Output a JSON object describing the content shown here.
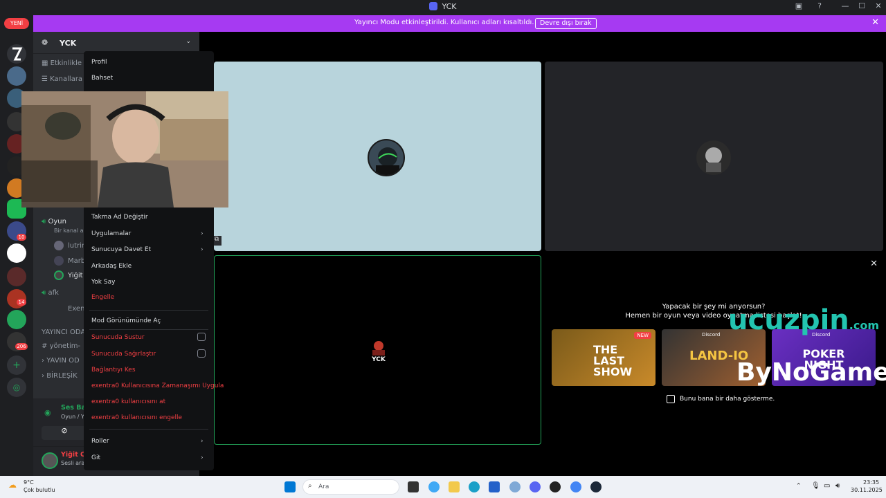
{
  "window": {
    "title": "YCK"
  },
  "banner": {
    "message": "Yayıncı Modu etkinleştirildi. Kullanıcı adları kısaltıldı.",
    "button": "Devre dışı bırak"
  },
  "rail": {
    "new_badge": "YENİ",
    "badges": [
      "10",
      "14",
      "206"
    ]
  },
  "server": {
    "name": "YCK",
    "channels": [
      {
        "label": "Etkinlikle"
      },
      {
        "label": "Kanallara"
      }
    ],
    "voice_channels": [
      {
        "name": "Oyun",
        "subtitle": "Bir kanal al",
        "members": [
          "lutrin",
          "Marb",
          "Yiğit"
        ]
      },
      {
        "name": "afk",
        "members": [
          "Exent"
        ]
      }
    ],
    "categories": [
      "YAYINCI ODAL",
      "yönetim-",
      "YAVIN OD",
      "BİRLEŞİK"
    ]
  },
  "voice_status": {
    "title": "Ses Bağlantısı Ku",
    "subtitle": "Oyun / YCK"
  },
  "user": {
    "name": "Yiğit Can Kasap",
    "status": "Sesli aramada"
  },
  "context_menu": {
    "items": [
      {
        "label": "Profil",
        "style": "normal"
      },
      {
        "label": "Bahset",
        "style": "normal"
      },
      {
        "label": "Takma Ad Değiştir",
        "style": "normal"
      },
      {
        "label": "Uygulamalar",
        "style": "normal",
        "submenu": true
      },
      {
        "label": "Sunucuya Davet Et",
        "style": "normal",
        "submenu": true
      },
      {
        "label": "Arkadaş Ekle",
        "style": "normal"
      },
      {
        "label": "Yok Say",
        "style": "normal"
      },
      {
        "label": "Engelle",
        "style": "danger"
      },
      {
        "label": "Mod Görünümünde Aç",
        "style": "normal"
      },
      {
        "label": "Sunucuda Sustur",
        "style": "danger",
        "checkbox": false
      },
      {
        "label": "Sunucuda Sağırlaştır",
        "style": "danger",
        "checkbox": false
      },
      {
        "label": "Bağlantıyı Kes",
        "style": "danger"
      },
      {
        "label": "exentra0 Kullanıcısına Zamanaşımı Uygula",
        "style": "danger"
      },
      {
        "label": "exentra0 kullanıcısını at",
        "style": "danger"
      },
      {
        "label": "exentra0 kullanıcısını engelle",
        "style": "danger"
      },
      {
        "label": "Roller",
        "style": "normal",
        "submenu": true
      },
      {
        "label": "Git",
        "style": "normal",
        "submenu": true
      }
    ]
  },
  "activity": {
    "heading": "Yapacak bir şey mi arıyorsun?",
    "subheading": "Hemen bir oyun veya video oynatma listesi başlat!",
    "games": [
      {
        "title": "THE LAST SHOW",
        "tag": "NEW"
      },
      {
        "title": "LAND-IO",
        "tag": "Discord"
      },
      {
        "title": "POKER NIGHT",
        "tag": "Discord"
      }
    ],
    "dont_show": "Bunu bana bir daha gösterme."
  },
  "overlays": {
    "watermark1": "ucuzpin",
    "watermark1_suffix": ".com",
    "watermark2": "ByNoGame"
  },
  "taskbar": {
    "weather_temp": "9°C",
    "weather_desc": "Çok bulutlu",
    "search_placeholder": "Ara",
    "time": "23:35",
    "date": "30.11.2025"
  },
  "colors": {
    "banner": "#a63af2",
    "speaking": "#23a55a",
    "danger": "#f23f43",
    "tile_blue": "#b8d4dc"
  }
}
